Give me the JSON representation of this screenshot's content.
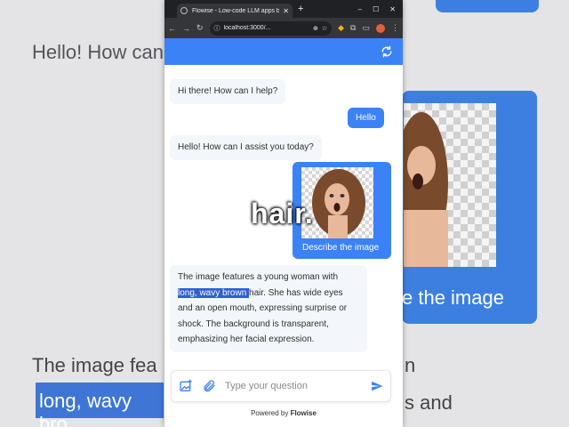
{
  "background": {
    "hello_text": "Hello! How can",
    "card_text": "e the image",
    "bottom_text_1": "The image fea",
    "bottom_text_2": "long, wavy bro",
    "right_text_1": "n",
    "right_text_2": "s and"
  },
  "browser": {
    "tab_title": "Flowise - Low-code LLM apps b",
    "url": "localhost:3000/..."
  },
  "chat": {
    "bot_greeting": "Hi there! How can I help?",
    "user_hello": "Hello",
    "bot_reply": "Hello! How can I assist you today?",
    "image_caption": "Describe the image",
    "answer_prefix": "The image features a young woman with ",
    "answer_highlight": "long, wavy brown ",
    "answer_rest": "hair. She has wide eyes and an open mouth, expressing surprise or shock. The background is transparent, emphasizing her facial expression."
  },
  "overlay_word": "hair.",
  "input": {
    "placeholder": "Type your question"
  },
  "footer": {
    "powered_prefix": "Powered by",
    "brand": "Flowise"
  },
  "colors": {
    "accent": "#3b82f6",
    "highlight": "#2f5fd0"
  }
}
